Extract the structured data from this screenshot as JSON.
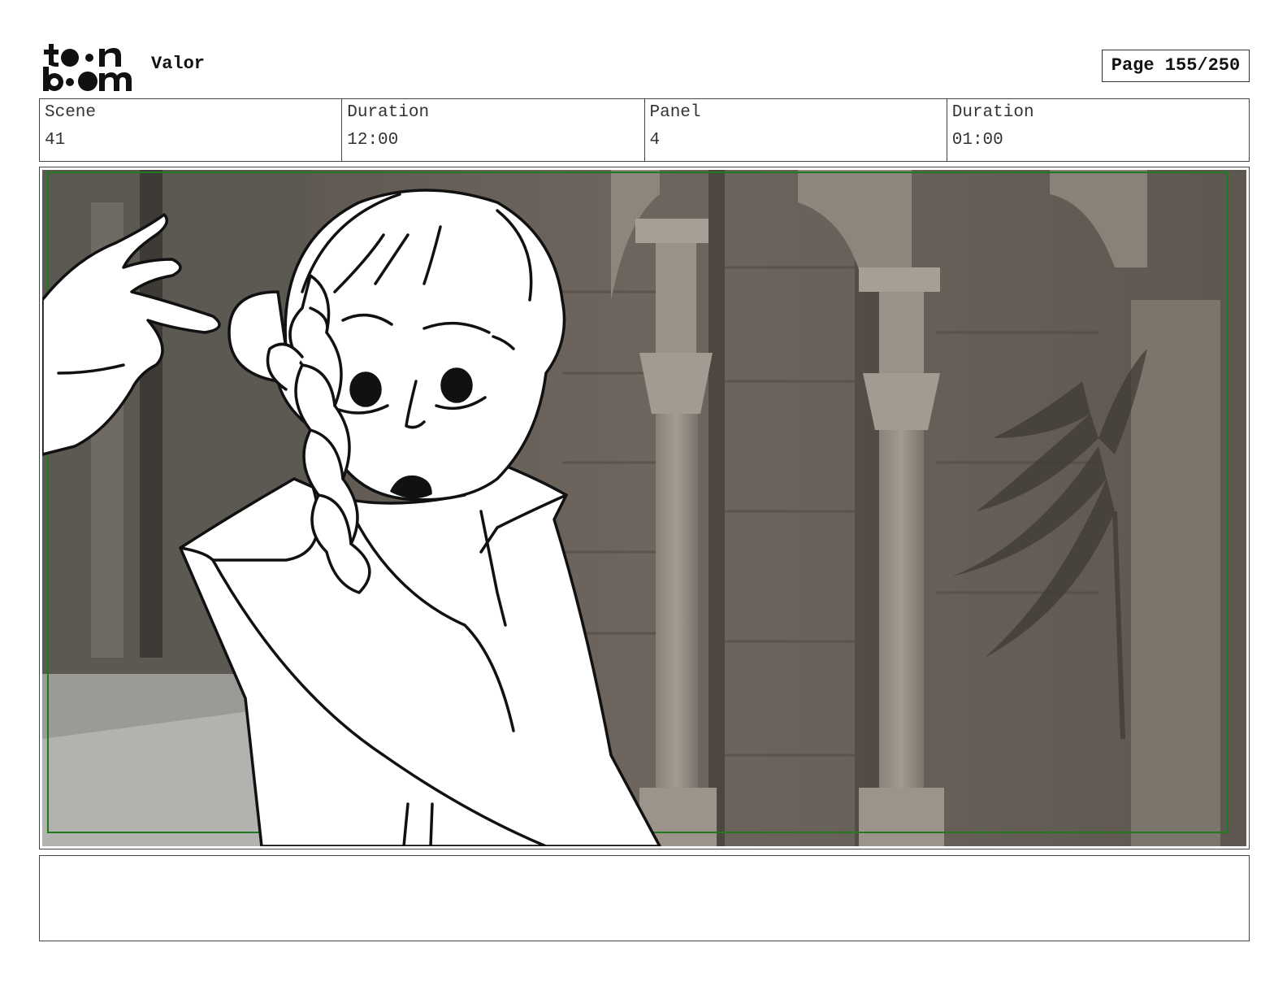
{
  "header": {
    "logo": {
      "icon": "toonboom-logo",
      "line1": "t••n",
      "line2": "b••m"
    },
    "project_title": "Valor",
    "page_label": "Page 155/250"
  },
  "scene_info": [
    {
      "label": "Scene",
      "value": "41"
    },
    {
      "label": "Duration",
      "value": "12:00"
    },
    {
      "label": "Panel",
      "value": "4"
    },
    {
      "label": "Duration",
      "value": "01:00"
    }
  ],
  "panel": {
    "image_icon": "storyboard-sketch-girl-with-braid",
    "background_color": "#6b645c",
    "safe_frame_color": "#1e7a1e"
  },
  "notes": {
    "text": ""
  }
}
